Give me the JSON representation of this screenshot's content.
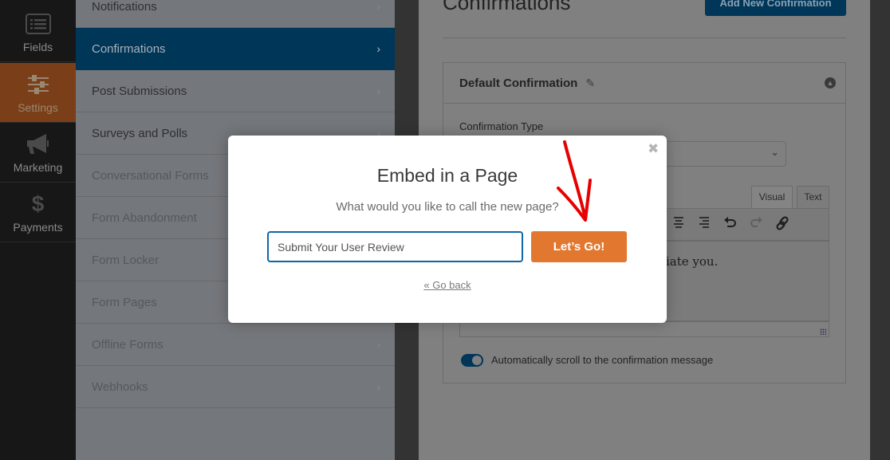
{
  "rail": {
    "items": [
      {
        "label": "Fields",
        "icon": "fields-list-icon",
        "active": false
      },
      {
        "label": "Settings",
        "icon": "sliders-icon",
        "active": true
      },
      {
        "label": "Marketing",
        "icon": "megaphone-icon",
        "active": false
      },
      {
        "label": "Payments",
        "icon": "dollar-icon",
        "active": false
      }
    ]
  },
  "settings_menu": {
    "items": [
      {
        "label": "Notifications"
      },
      {
        "label": "Confirmations",
        "active": true
      },
      {
        "label": "Post Submissions"
      },
      {
        "label": "Surveys and Polls"
      },
      {
        "label": "Conversational Forms"
      },
      {
        "label": "Form Abandonment"
      },
      {
        "label": "Form Locker"
      },
      {
        "label": "Form Pages"
      },
      {
        "label": "Offline Forms"
      },
      {
        "label": "Webhooks"
      }
    ],
    "chevron": "›"
  },
  "content": {
    "title": "Confirmations",
    "add_button": "Add New Confirmation",
    "panel": {
      "title": "Default Confirmation",
      "type_label": "Confirmation Type",
      "select_value": "",
      "tabs": [
        "Visual",
        "Text"
      ],
      "active_tab": "Visual",
      "toolbar_icons": [
        "align-center-icon",
        "align-right-icon",
        "undo-icon",
        "redo-icon",
        "link-icon"
      ],
      "editor_text_visible": "iate you.",
      "toggle_label": "Automatically scroll to the confirmation message",
      "toggle_on": true
    }
  },
  "modal": {
    "title": "Embed in a Page",
    "subtitle": "What would you like to call the new page?",
    "input_value": "Submit Your User Review",
    "submit_label": "Let’s Go!",
    "back_link": "« Go back",
    "close_glyph": "✖"
  },
  "colors": {
    "accent_orange": "#e27730",
    "active_blue": "#003658",
    "input_border": "#0e67a8",
    "annotation_red": "#e60000"
  }
}
